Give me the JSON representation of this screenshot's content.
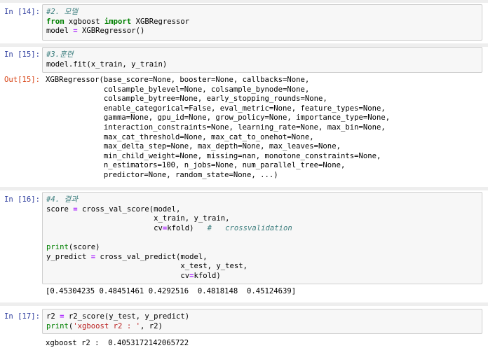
{
  "cells": [
    {
      "prompt": "In [14]:",
      "lines": [
        {
          "comment": "#2. 모델"
        },
        {
          "kw1": "from",
          "t1": " xgboost ",
          "kw2": "import",
          "t2": " XGBRegressor"
        },
        {
          "pre": "model ",
          "op": "=",
          "post": " XGBRegressor()"
        }
      ]
    },
    {
      "prompt": "In [15]:",
      "lines": [
        {
          "comment": "#3.훈련"
        },
        {
          "text": "model.fit(x_train, y_train)"
        }
      ],
      "out_prompt": "Out[15]:",
      "output": [
        "XGBRegressor(base_score=None, booster=None, callbacks=None,",
        "             colsample_bylevel=None, colsample_bynode=None,",
        "             colsample_bytree=None, early_stopping_rounds=None,",
        "             enable_categorical=False, eval_metric=None, feature_types=None,",
        "             gamma=None, gpu_id=None, grow_policy=None, importance_type=None,",
        "             interaction_constraints=None, learning_rate=None, max_bin=None,",
        "             max_cat_threshold=None, max_cat_to_onehot=None,",
        "             max_delta_step=None, max_depth=None, max_leaves=None,",
        "             min_child_weight=None, missing=nan, monotone_constraints=None,",
        "             n_estimators=100, n_jobs=None, num_parallel_tree=None,",
        "             predictor=None, random_state=None, ...)"
      ]
    },
    {
      "prompt": "In [16]:",
      "lines": [
        {
          "comment": "#4. 결과"
        },
        {
          "pre": "score ",
          "op": "=",
          "post": " cross_val_score(model,"
        },
        {
          "text": "                        x_train, y_train,"
        },
        {
          "pre": "                        cv",
          "op": "=",
          "post": "kfold)   ",
          "comment": "#   crossvalidation"
        },
        {
          "text": ""
        },
        {
          "bi": "print",
          "post": "(score)"
        },
        {
          "pre": "y_predict ",
          "op": "=",
          "post": " cross_val_predict(model,"
        },
        {
          "text": "                              x_test, y_test,"
        },
        {
          "pre": "                              cv",
          "op": "=",
          "post": "kfold)"
        }
      ],
      "output": [
        "[0.45304235 0.48451461 0.4292516  0.4818148  0.45124639]"
      ]
    },
    {
      "prompt": "In [17]:",
      "lines": [
        {
          "pre": "r2 ",
          "op": "=",
          "post": " r2_score(y_test, y_predict)"
        },
        {
          "bi": "print",
          "post": "(",
          "str": "'xgboost r2 : '",
          "post2": ", r2)"
        }
      ],
      "output": [
        "xgboost r2 :  0.4053172142065722"
      ]
    }
  ]
}
